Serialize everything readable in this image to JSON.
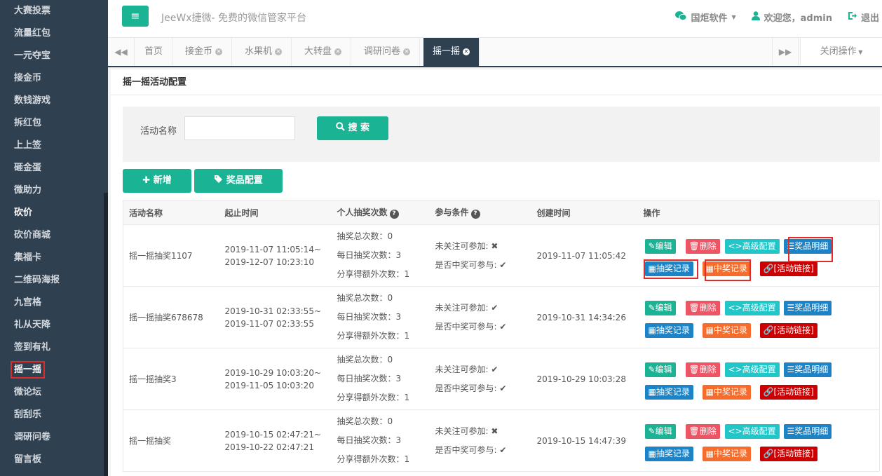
{
  "sidebar": {
    "items": [
      {
        "label": "大赛投票"
      },
      {
        "label": "流量红包"
      },
      {
        "label": "一元夺宝"
      },
      {
        "label": "接金币"
      },
      {
        "label": "数钱游戏"
      },
      {
        "label": "拆红包"
      },
      {
        "label": "上上签"
      },
      {
        "label": "砸金蛋"
      },
      {
        "label": "微助力"
      },
      {
        "label": "砍价"
      },
      {
        "label": "砍价商城"
      },
      {
        "label": "集福卡"
      },
      {
        "label": "二维码海报"
      },
      {
        "label": "九宫格"
      },
      {
        "label": "礼从天降"
      },
      {
        "label": "签到有礼"
      },
      {
        "label": "摇一摇"
      },
      {
        "label": "微论坛"
      },
      {
        "label": "刮刮乐"
      },
      {
        "label": "调研问卷"
      },
      {
        "label": "留言板"
      }
    ]
  },
  "header": {
    "menu_icon": "≡",
    "title": "JeeWx捷微- 免费的微信管家平台",
    "company": "国炬软件",
    "welcome": "欢迎您，admin",
    "logout": "退出"
  },
  "tabs": {
    "items": [
      {
        "label": "首页"
      },
      {
        "label": "接金币"
      },
      {
        "label": "水果机"
      },
      {
        "label": "大转盘"
      },
      {
        "label": "调研问卷"
      },
      {
        "label": "摇一摇"
      }
    ],
    "close_ops": "关闭操作"
  },
  "panel": {
    "title": "摇一摇活动配置"
  },
  "search": {
    "label": "活动名称",
    "value": "",
    "button": "搜 索"
  },
  "actions": {
    "add": "新增",
    "prize_config": "奖品配置"
  },
  "table": {
    "headers": [
      "活动名称",
      "起止时间",
      "个人抽奖次数",
      "参与条件",
      "创建时间",
      "操作"
    ],
    "rows": [
      {
        "name": "摇一摇抽奖1107",
        "start": "2019-11-07 11:05:14~",
        "end": "2019-12-07 10:23:10",
        "total": "抽奖总次数：0",
        "daily": "每日抽奖次数：3",
        "share": "分享得额外次数：1",
        "cond1": "未关注可参加:",
        "cond1_icon": "✖",
        "cond2": "是否中奖可参与:",
        "cond2_icon": "✔",
        "created": "2019-11-07 11:05:42"
      },
      {
        "name": "摇一摇抽奖678678",
        "start": "2019-10-31 02:33:55~",
        "end": "2019-11-07 02:33:55",
        "total": "抽奖总次数：0",
        "daily": "每日抽奖次数：3",
        "share": "分享得额外次数：1",
        "cond1": "未关注可参加:",
        "cond1_icon": "✔",
        "cond2": "是否中奖可参与:",
        "cond2_icon": "✔",
        "created": "2019-10-31 14:34:26"
      },
      {
        "name": "摇一摇抽奖3",
        "start": "2019-10-29 10:03:20~",
        "end": "2019-11-05 10:03:20",
        "total": "抽奖总次数：0",
        "daily": "每日抽奖次数：3",
        "share": "分享得额外次数：1",
        "cond1": "未关注可参加:",
        "cond1_icon": "✔",
        "cond2": "是否中奖可参与:",
        "cond2_icon": "✔",
        "created": "2019-10-29 10:03:28"
      },
      {
        "name": "摇一摇抽奖",
        "start": "2019-10-15 02:47:21~",
        "end": "2019-10-22 02:47:21",
        "total": "抽奖总次数：0",
        "daily": "每日抽奖次数：3",
        "share": "分享得额外次数：1",
        "cond1": "未关注可参加:",
        "cond1_icon": "✖",
        "cond2": "是否中奖可参与:",
        "cond2_icon": "✔",
        "created": "2019-10-15 14:47:39"
      }
    ],
    "ops": {
      "edit": "编辑",
      "delete": "删除",
      "advanced": "高级配置",
      "prize_detail": "奖品明细",
      "draw_record": "抽奖记录",
      "win_record": "中奖记录",
      "link": "[活动链接]"
    }
  },
  "colors": {
    "sidebar_bg": "#2f4050",
    "primary": "#1ab394",
    "danger": "#ed5565",
    "info": "#23c6c8",
    "blue": "#1c84c6",
    "orange": "#f56c2c",
    "dark_red": "#cc0000",
    "highlight": "#e02b2b"
  }
}
